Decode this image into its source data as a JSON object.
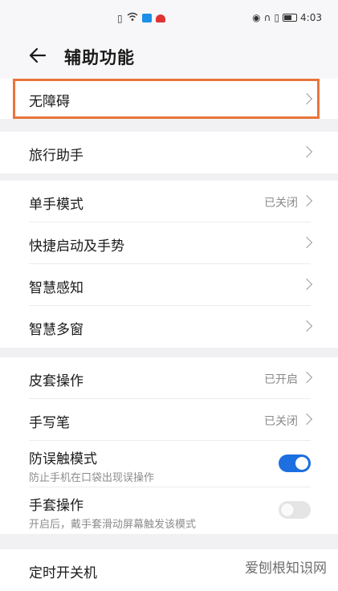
{
  "status_bar": {
    "time": "4:03",
    "left_icons": [
      "sim-icon",
      "wifi-icon",
      "weather-icon",
      "huawei-icon"
    ],
    "right_icons": [
      "eye-icon",
      "headphone-icon",
      "vibrate-icon",
      "battery-icon"
    ]
  },
  "header": {
    "back_icon": "arrow-left-icon",
    "title": "辅助功能"
  },
  "groups": [
    {
      "rows": [
        {
          "label": "无障碍"
        }
      ]
    },
    {
      "rows": [
        {
          "label": "旅行助手"
        }
      ]
    },
    {
      "rows": [
        {
          "label": "单手模式",
          "value": "已关闭"
        },
        {
          "label": "快捷启动及手势"
        },
        {
          "label": "智慧感知"
        },
        {
          "label": "智慧多窗"
        }
      ]
    },
    {
      "rows": [
        {
          "label": "皮套操作",
          "value": "已开启"
        },
        {
          "label": "手写笔",
          "value": "已关闭"
        },
        {
          "label": "防误触模式",
          "sub": "防止手机在口袋出现误操作",
          "toggle": true
        },
        {
          "label": "手套操作",
          "sub": "开启后，戴手套滑动屏幕触发该模式",
          "toggle": false
        }
      ]
    },
    {
      "rows": [
        {
          "label": "定时开关机"
        }
      ]
    }
  ],
  "colors": {
    "highlight": "#e8753a",
    "toggle_on": "#1e6fe0"
  },
  "watermark": "爱刨根知识网"
}
